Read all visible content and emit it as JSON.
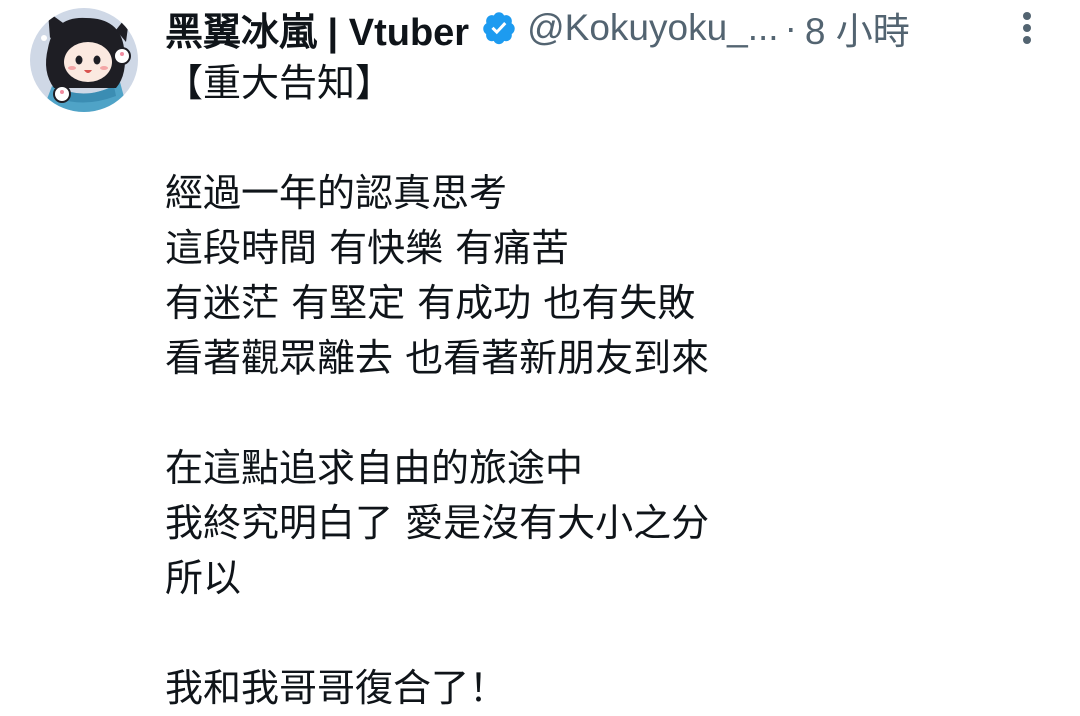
{
  "tweet": {
    "author": {
      "display_name": "黑翼冰嵐 | Vtuber",
      "handle": "@Kokuyoku_...",
      "verified_icon": "verified-badge-icon",
      "avatar_icon": "avatar-icon"
    },
    "separator": "·",
    "time": "8 小時",
    "more_icon": "more-options-icon",
    "colors": {
      "text": "#0f1419",
      "secondary": "#536471",
      "verified": "#1d9bf0"
    },
    "lines": [
      "【重大告知】",
      "",
      "經過一年的認真思考",
      "這段時間 有快樂 有痛苦",
      "有迷茫 有堅定 有成功 也有失敗",
      "看著觀眾離去 也看著新朋友到來",
      "",
      "在這點追求自由的旅途中",
      "我終究明白了 愛是沒有大小之分",
      "所以",
      "",
      "我和我哥哥復合了！"
    ]
  }
}
